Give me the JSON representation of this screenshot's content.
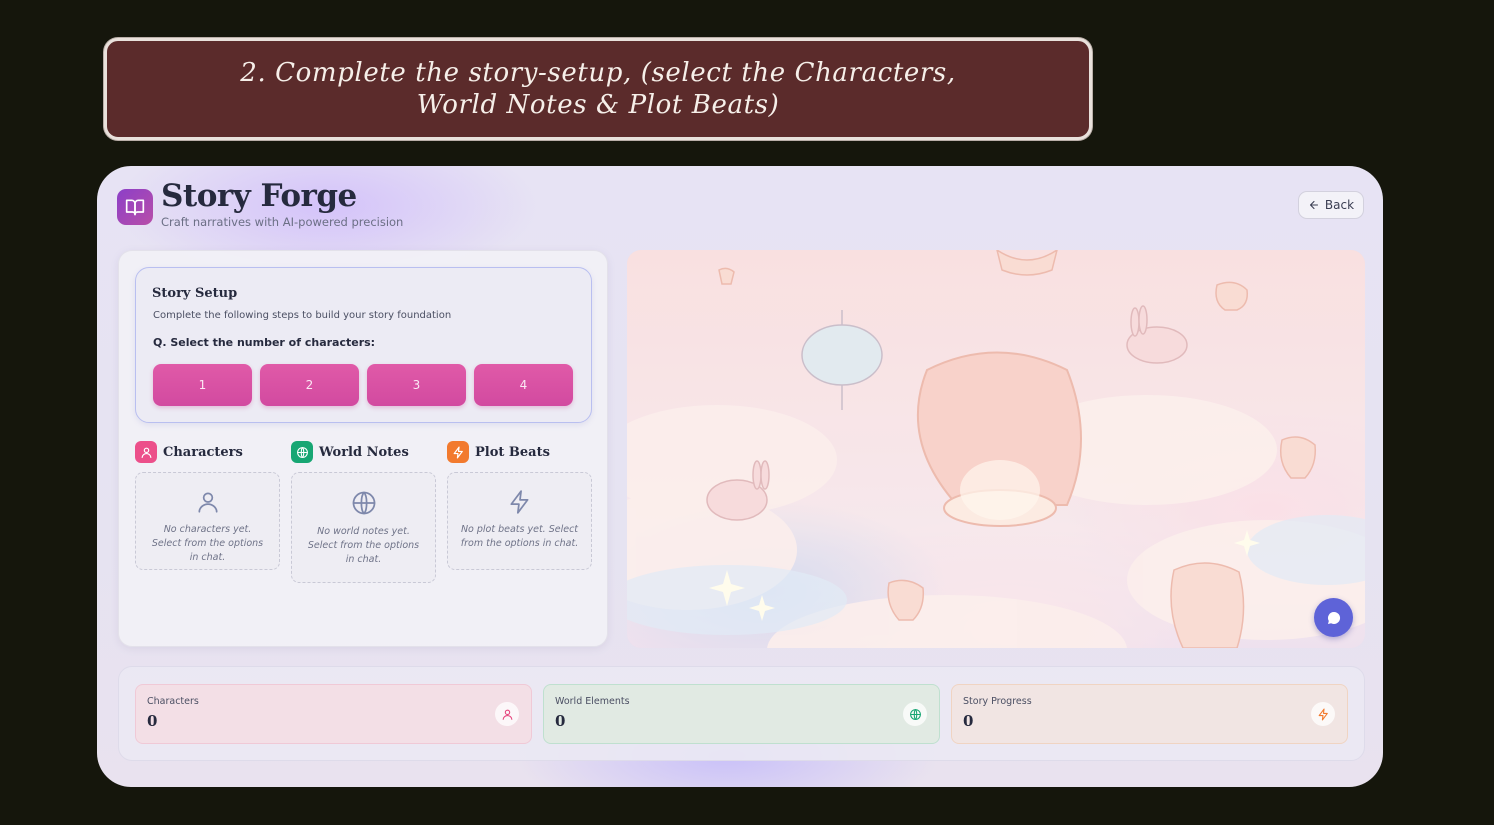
{
  "banner": {
    "text": "2. Complete the story-setup, (select the Characters, World Notes & Plot Beats)"
  },
  "header": {
    "title": "Story Forge",
    "subtitle": "Craft narratives with AI-powered precision",
    "back_label": "Back"
  },
  "setup": {
    "title": "Story Setup",
    "description": "Complete the following steps to build your story foundation",
    "question": "Q. Select the number of characters:",
    "options": [
      "1",
      "2",
      "3",
      "4"
    ]
  },
  "sections": {
    "characters": {
      "label": "Characters",
      "empty": "No characters yet. Select from the options in chat."
    },
    "world_notes": {
      "label": "World Notes",
      "empty": "No world notes yet. Select from the options in chat."
    },
    "plot_beats": {
      "label": "Plot Beats",
      "empty": "No plot beats yet. Select from the options in chat."
    }
  },
  "stats": [
    {
      "label": "Characters",
      "value": "0"
    },
    {
      "label": "World Elements",
      "value": "0"
    },
    {
      "label": "Story Progress",
      "value": "0"
    }
  ],
  "colors": {
    "accent_pink": "#d94fa3",
    "characters": "#e6477f",
    "world": "#17a673",
    "plot": "#f27a2e",
    "fab": "#5e63d8"
  }
}
